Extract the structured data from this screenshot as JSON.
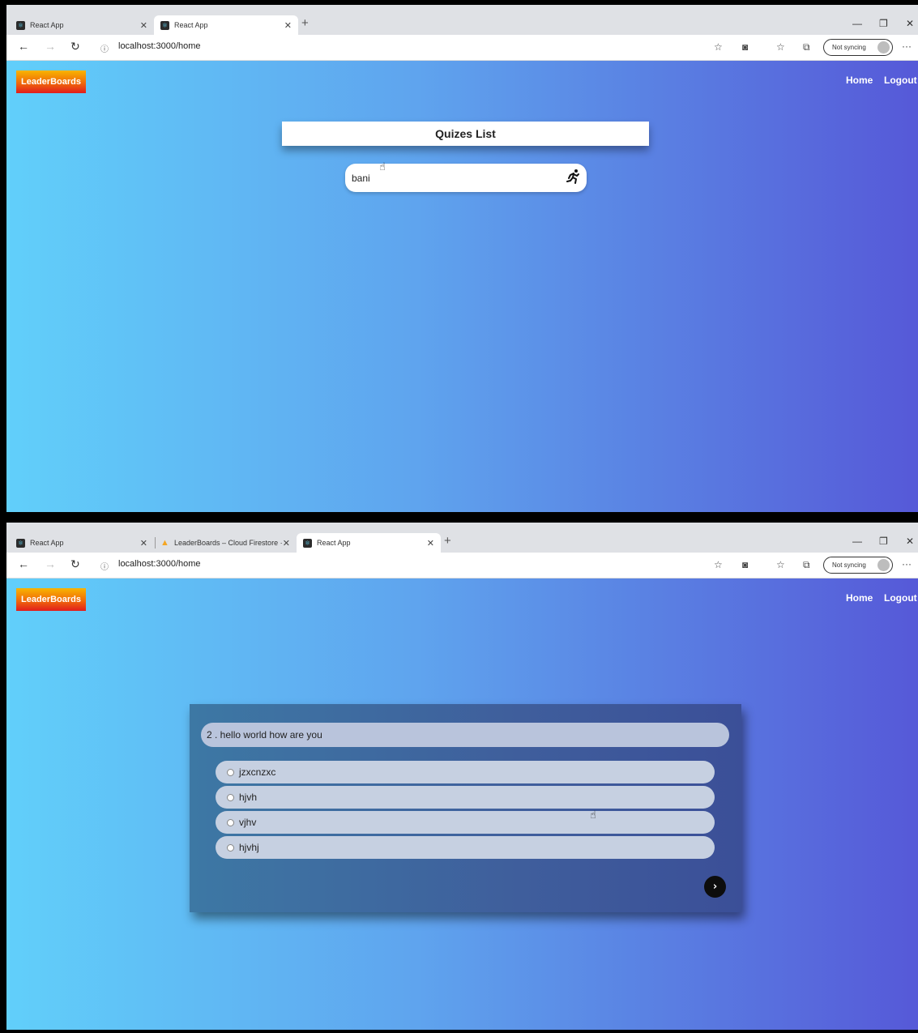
{
  "screen1": {
    "tabs": [
      {
        "label": "React App"
      },
      {
        "label": "React App"
      }
    ],
    "url": "localhost:3000/home",
    "sync_label": "Not syncing",
    "logo": "LeaderBoards",
    "nav": {
      "home": "Home",
      "logout": "Logout"
    },
    "list_title": "Quizes List",
    "quizzes": [
      {
        "name": "bani",
        "icon": "running-person-icon"
      }
    ]
  },
  "screen2": {
    "tabs": [
      {
        "label": "React App"
      },
      {
        "label": "LeaderBoards – Cloud Firestore ·"
      },
      {
        "label": "React App"
      }
    ],
    "url": "localhost:3000/home",
    "sync_label": "Not syncing",
    "logo": "LeaderBoards",
    "nav": {
      "home": "Home",
      "logout": "Logout"
    },
    "question": "2 . hello world how are you",
    "options": [
      "jzxcnzxc",
      "hjvh",
      "vjhv",
      "hjvhj"
    ]
  }
}
